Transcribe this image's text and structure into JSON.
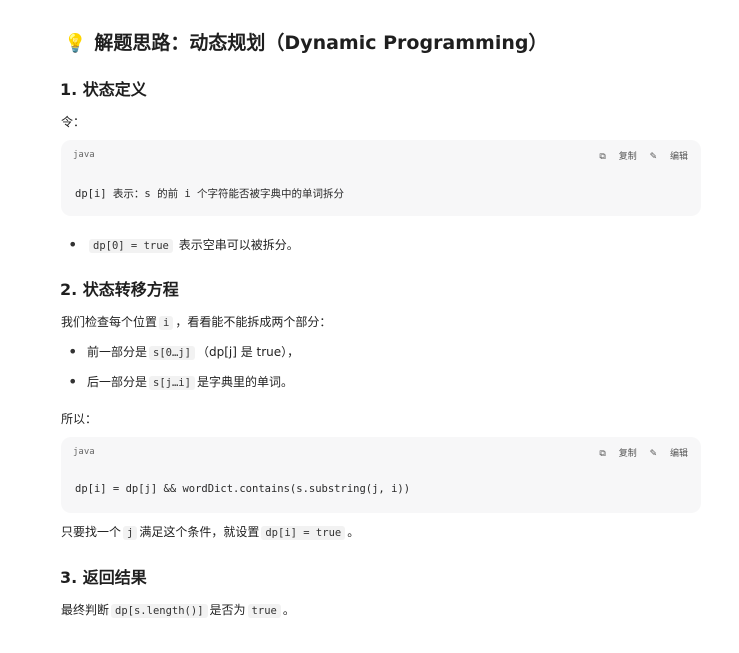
{
  "title": {
    "icon": "lightbulb-icon",
    "text": "解题思路：动态规划（Dynamic Programming）"
  },
  "s1": {
    "heading": "1. 状态定义",
    "intro": "令：",
    "code": {
      "lang": "java",
      "copy": "复制",
      "edit": "编辑",
      "line": "dp[i] 表示：s 的前 i 个字符能否被字典中的单词拆分"
    },
    "bullet_code": "dp[0] = true",
    "bullet_text": "表示空串可以被拆分。"
  },
  "s2": {
    "heading": "2. 状态转移方程",
    "p1_a": "我们检查每个位置",
    "p1_code": "i",
    "p1_b": "，看看能不能拆成两个部分：",
    "b1_a": "前一部分是",
    "b1_code": "s[0…j]",
    "b1_b": "（dp[j] 是 true），",
    "b2_a": "后一部分是",
    "b2_code": "s[j…i]",
    "b2_b": "是字典里的单词。",
    "so": "所以：",
    "code": {
      "lang": "java",
      "copy": "复制",
      "edit": "编辑",
      "line": "dp[i] = dp[j] && wordDict.contains(s.substring(j, i))"
    },
    "p2_a": "只要找一个",
    "p2_code1": "j",
    "p2_b": "满足这个条件，就设置",
    "p2_code2": "dp[i] = true",
    "p2_c": "。"
  },
  "s3": {
    "heading": "3. 返回结果",
    "p_a": "最终判断",
    "p_code1": "dp[s.length()]",
    "p_b": "是否为",
    "p_code2": "true",
    "p_c": "。"
  }
}
